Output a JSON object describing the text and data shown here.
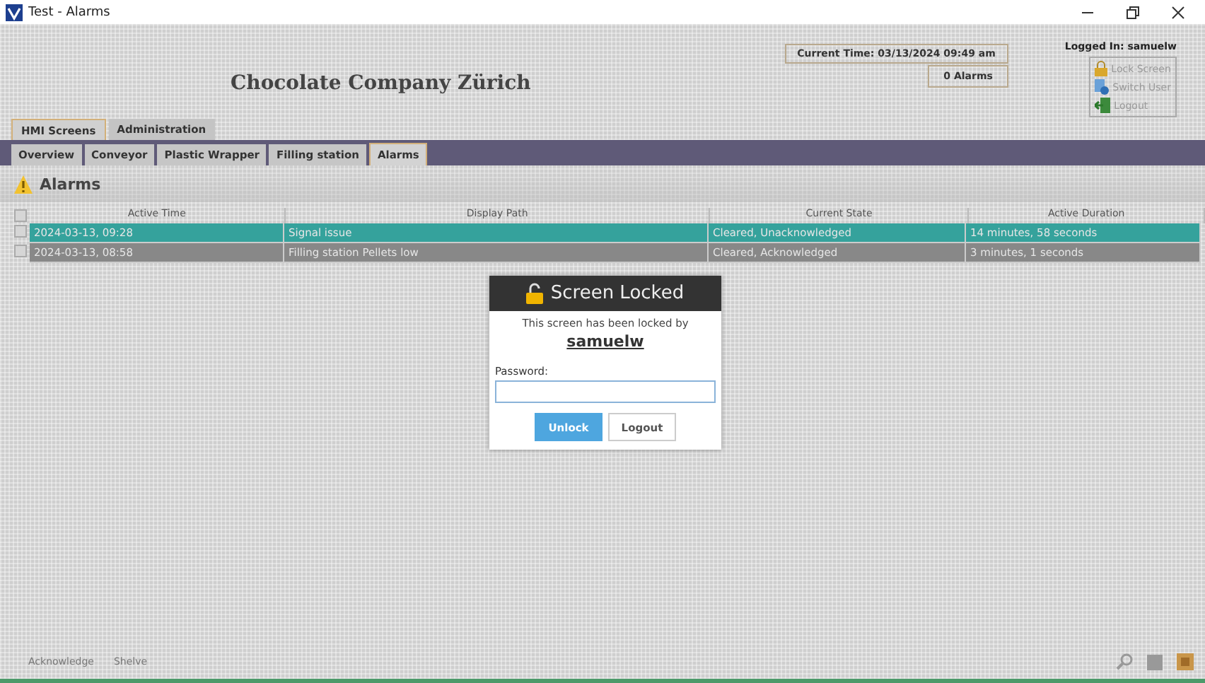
{
  "window": {
    "title": "Test - Alarms"
  },
  "header": {
    "company": "Chocolate Company Zürich",
    "current_time": "Current Time: 03/13/2024 09:49 am",
    "alarm_count": "0 Alarms",
    "logged_in": "Logged In: samuelw",
    "user_menu": [
      {
        "kind": "lock",
        "label": "Lock Screen",
        "disabled": true
      },
      {
        "kind": "switch",
        "label": "Switch User",
        "disabled": true
      },
      {
        "kind": "logout",
        "label": "Logout",
        "disabled": true
      }
    ]
  },
  "primary_tabs": [
    {
      "label": "HMI Screens",
      "selected": true
    },
    {
      "label": "Administration",
      "selected": false
    }
  ],
  "secondary_tabs": [
    {
      "label": "Overview",
      "selected": false
    },
    {
      "label": "Conveyor",
      "selected": false
    },
    {
      "label": "Plastic Wrapper",
      "selected": false
    },
    {
      "label": "Filling station",
      "selected": false
    },
    {
      "label": "Alarms",
      "selected": true
    }
  ],
  "page_title": "Alarms",
  "table": {
    "all_checked": false,
    "columns": [
      "Active Time",
      "Display Path",
      "Current State",
      "Active Duration"
    ],
    "rows": [
      {
        "cells": [
          "2024-03-13, 09:28",
          "Signal issue",
          "Cleared, Unacknowledged",
          "14 minutes, 58 seconds"
        ],
        "selected": true,
        "checked": false
      },
      {
        "cells": [
          "2024-03-13, 08:58",
          "Filling station Pellets low",
          "Cleared, Acknowledged",
          "3 minutes, 1 seconds"
        ],
        "selected": false,
        "checked": false
      }
    ]
  },
  "footer_buttons": [
    {
      "label": "Acknowledge",
      "disabled": true
    },
    {
      "label": "Shelve",
      "disabled": true
    }
  ],
  "lock_dialog": {
    "title": "Screen Locked",
    "message": "This screen has been locked by",
    "user": "samuelw",
    "password_label": "Password:",
    "buttons": [
      {
        "kind": "primary",
        "label": "Unlock"
      },
      {
        "kind": "secondary",
        "label": "Logout"
      }
    ]
  }
}
